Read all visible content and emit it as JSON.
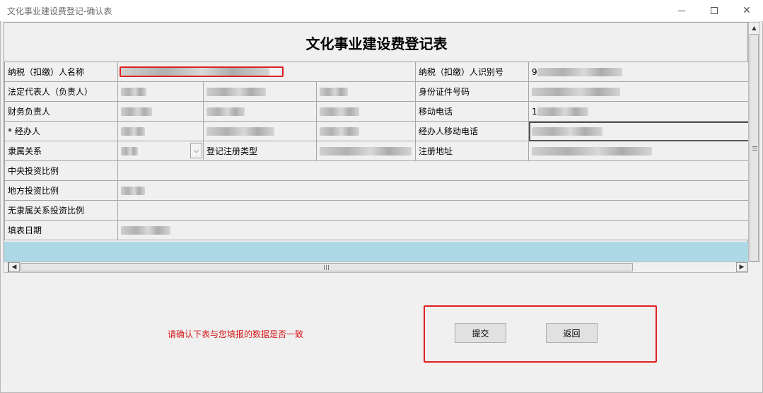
{
  "window": {
    "title": "文化事业建设费登记-确认表",
    "controls": {
      "minimize": "minimize-icon",
      "maximize": "maximize-icon",
      "close": "close-icon"
    }
  },
  "form": {
    "title": "文化事业建设费登记表",
    "rows": [
      {
        "label": "纳税（扣缴）人名称",
        "right_label": "纳税（扣缴）人识别号",
        "right_value_prefix": "9"
      },
      {
        "label": "法定代表人（负责人）",
        "right_label": "身份证件号码"
      },
      {
        "label": "财务负责人",
        "right_label": "移动电话",
        "right_value_prefix": "1"
      },
      {
        "label": "*  经办人",
        "right_label": "经办人移动电话"
      },
      {
        "label": "隶属关系",
        "mid_label": "登记注册类型",
        "right_label": "注册地址"
      },
      {
        "label": "中央投资比例"
      },
      {
        "label": "地方投资比例"
      },
      {
        "label": "无隶属关系投资比例"
      },
      {
        "label": "填表日期"
      }
    ]
  },
  "footer": {
    "confirm_message": "请确认下表与您填报的数据是否一致",
    "submit_label": "提交",
    "back_label": "返回"
  },
  "colors": {
    "highlight": "#e02020",
    "message": "#d61616",
    "empty_row": "#add8e6"
  }
}
